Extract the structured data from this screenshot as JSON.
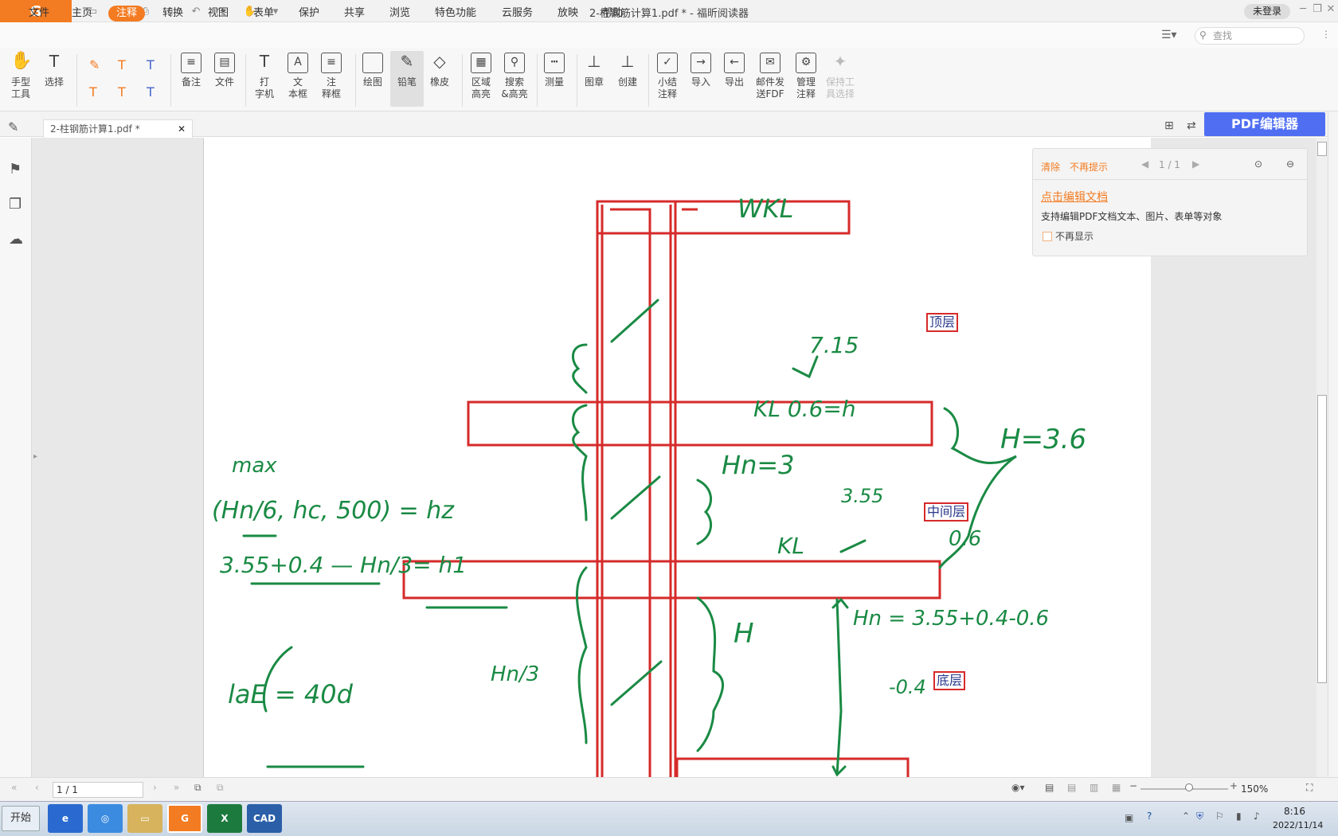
{
  "app": {
    "title": "2-柱钢筋计算1.pdf * - 福昕阅读器",
    "login": "未登录",
    "search_placeholder": "查找"
  },
  "menu": [
    "文件",
    "主页",
    "注释",
    "转换",
    "视图",
    "表单",
    "保护",
    "共享",
    "浏览",
    "特色功能",
    "云服务",
    "放映",
    "帮助"
  ],
  "tools": {
    "hand": "手型\n工具",
    "select": "选择",
    "note": "备注",
    "file": "文件",
    "typewriter": "打\n字机",
    "textbox": "文\n本框",
    "callout": "注\n释框",
    "draw": "绘图",
    "pencil": "铅笔",
    "eraser": "橡皮",
    "area_highlight": "区域\n高亮",
    "search_highlight": "搜索\n&高亮",
    "measure": "测量",
    "stamp": "图章",
    "create": "创建",
    "summarize": "小结\n注释",
    "import": "导入",
    "export": "导出",
    "email": "邮件发\n送FDF",
    "manage": "管理\n注释",
    "keep": "保持工\n具选择"
  },
  "doc_tab": "2-柱钢筋计算1.pdf *",
  "pdf_editor": "PDF编辑器",
  "popup": {
    "clear": "清除",
    "no_prompt": "不再提示",
    "pager": "1 / 1",
    "link": "点击编辑文档",
    "desc": "支持编辑PDF文档文本、图片、表单等对象",
    "checkbox": "不再显示"
  },
  "labels": {
    "top": "顶层",
    "middle": "中间层",
    "bottom": "底层"
  },
  "handwriting": {
    "wkl": "WKL",
    "kl1": "KL 0.6=h",
    "kl2": "KL",
    "h36": "H=3.6",
    "hn3": "Hn=3",
    "max": "max",
    "hz": "(Hn/6, hc, 500) = hz",
    "h1": "3.55+0.4 — Hn/3= h1",
    "lae": "laE = 40d",
    "hn_over3": "Hn/3",
    "h": "H",
    "hn_expr": "Hn = 3.55+0.4-0.6",
    "v15": "7.15",
    "v355": "3.55",
    "v06": "0.6",
    "v04": "-0.4"
  },
  "status": {
    "page": "1 / 1",
    "zoom": "150%"
  },
  "taskbar": {
    "start": "开始",
    "time": "8:16",
    "date": "2022/11/14"
  },
  "colors": {
    "accent": "#f37b21",
    "ink": "#1a8a44",
    "frame": "#d62a2a",
    "editor": "#4f6ef2"
  }
}
